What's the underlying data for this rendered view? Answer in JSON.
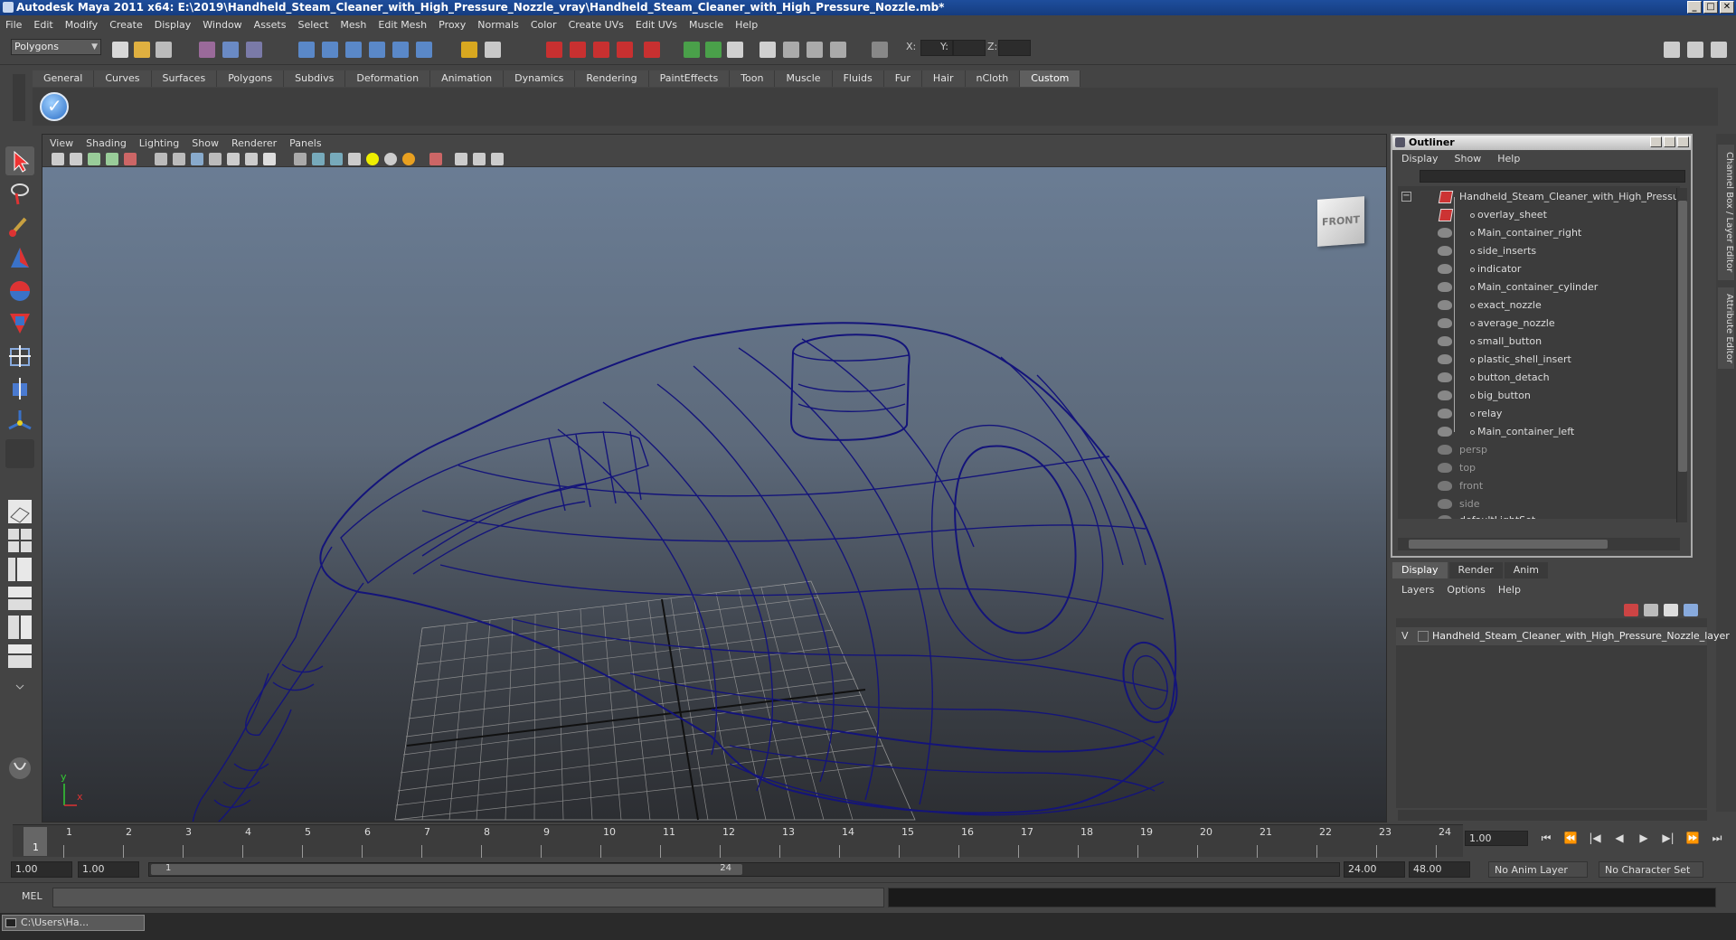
{
  "window": {
    "title": "Autodesk Maya 2011 x64: E:\\2019\\Handheld_Steam_Cleaner_with_High_Pressure_Nozzle_vray\\Handheld_Steam_Cleaner_with_High_Pressure_Nozzle.mb*",
    "minimize": "_",
    "restore": "□",
    "close": "✕"
  },
  "menubar": [
    "File",
    "Edit",
    "Modify",
    "Create",
    "Display",
    "Window",
    "Assets",
    "Select",
    "Mesh",
    "Edit Mesh",
    "Proxy",
    "Normals",
    "Color",
    "Create UVs",
    "Edit UVs",
    "Muscle",
    "Help"
  ],
  "statusline": {
    "mode": "Polygons",
    "x_label": "X:",
    "y_label": "Y:",
    "z_label": "Z:"
  },
  "shelf": {
    "tabs": [
      "General",
      "Curves",
      "Surfaces",
      "Polygons",
      "Subdivs",
      "Deformation",
      "Animation",
      "Dynamics",
      "Rendering",
      "PaintEffects",
      "Toon",
      "Muscle",
      "Fluids",
      "Fur",
      "Hair",
      "nCloth",
      "Custom"
    ],
    "active_tab": "Custom"
  },
  "viewport": {
    "menu": [
      "View",
      "Shading",
      "Lighting",
      "Show",
      "Renderer",
      "Panels"
    ],
    "viewcube_label": "FRONT",
    "axis_y": "y",
    "axis_x": "x",
    "wire_color": "#14147a"
  },
  "outliner": {
    "title": "Outliner",
    "menu": [
      "Display",
      "Show",
      "Help"
    ],
    "root": "Handheld_Steam_Cleaner_with_High_Pressure_",
    "children": [
      "overlay_sheet",
      "Main_container_right",
      "side_inserts",
      "indicator",
      "Main_container_cylinder",
      "exact_nozzle",
      "average_nozzle",
      "small_button",
      "plastic_shell_insert",
      "button_detach",
      "big_button",
      "relay",
      "Main_container_left"
    ],
    "cameras": [
      "persp",
      "top",
      "front",
      "side",
      "defaultLightSet"
    ],
    "expand_toggle": "−"
  },
  "sidetabs": [
    "Channel Box / Layer Editor",
    "Attribute Editor"
  ],
  "layer_editor": {
    "tabs": [
      "Display",
      "Render",
      "Anim"
    ],
    "active_tab": "Display",
    "menu": [
      "Layers",
      "Options",
      "Help"
    ],
    "layer_visible": "V",
    "layer_name": "Handheld_Steam_Cleaner_with_High_Pressure_Nozzle_layer"
  },
  "timeline": {
    "ticks": [
      "1",
      "2",
      "3",
      "4",
      "5",
      "6",
      "7",
      "8",
      "9",
      "10",
      "11",
      "12",
      "13",
      "14",
      "15",
      "16",
      "17",
      "18",
      "19",
      "20",
      "21",
      "22",
      "23",
      "24"
    ],
    "current_frame_marker": "1",
    "current_frame": "1.00",
    "play_controls": [
      "⏮",
      "⏪",
      "|◀",
      "◀",
      "▶",
      "▶|",
      "⏩",
      "⏭"
    ]
  },
  "range": {
    "start": "1.00",
    "playback_start": "1.00",
    "thumb_left": "1",
    "thumb_right": "24",
    "playback_end": "24.00",
    "end": "48.00",
    "anim_layer": "No Anim Layer",
    "character_set": "No Character Set"
  },
  "cmdline": {
    "label": "MEL"
  },
  "taskbar": {
    "item": "C:\\Users\\Ha..."
  }
}
